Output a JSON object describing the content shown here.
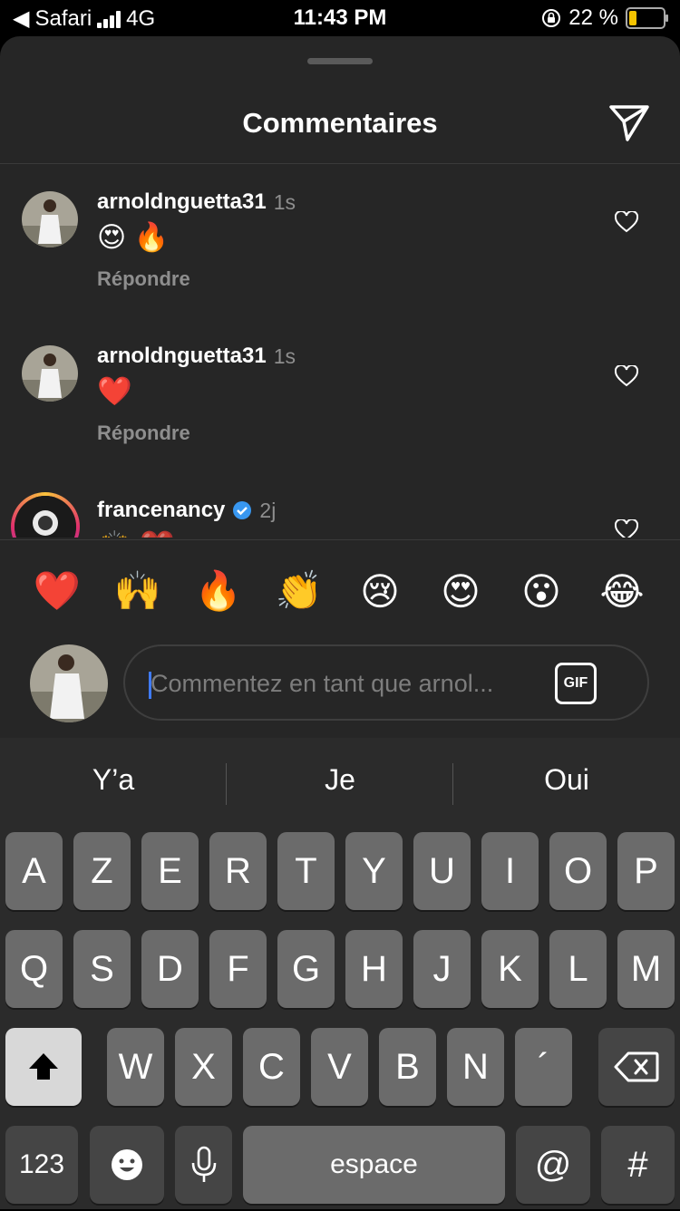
{
  "status_bar": {
    "back_app": "Safari",
    "network": "4G",
    "time": "11:43 PM",
    "battery_percent": "22 %",
    "battery_level": 0.22
  },
  "sheet": {
    "title": "Commentaires"
  },
  "comments": [
    {
      "username": "arnoldnguetta31",
      "time": "1s",
      "text": "😍 🔥",
      "reply_label": "Répondre",
      "verified": false
    },
    {
      "username": "arnoldnguetta31",
      "time": "1s",
      "text": "❤️",
      "reply_label": "Répondre",
      "verified": false
    },
    {
      "username": "francenancy",
      "time": "2j",
      "text": "🙌 ❤️",
      "verified": true
    }
  ],
  "reactions": [
    "❤️",
    "🙌",
    "🔥",
    "👏",
    "😢",
    "😍",
    "😮",
    "😂"
  ],
  "composer": {
    "placeholder": "Commentez en tant que arnol...",
    "gif_label": "GIF"
  },
  "keyboard": {
    "suggestions": [
      "Y’a",
      "Je",
      "Oui"
    ],
    "row1": [
      "A",
      "Z",
      "E",
      "R",
      "T",
      "Y",
      "U",
      "I",
      "O",
      "P"
    ],
    "row2": [
      "Q",
      "S",
      "D",
      "F",
      "G",
      "H",
      "J",
      "K",
      "L",
      "M"
    ],
    "row3": [
      "W",
      "X",
      "C",
      "V",
      "B",
      "N",
      "´"
    ],
    "numbers_key": "123",
    "space_key": "espace",
    "at_key": "@",
    "hash_key": "#"
  },
  "colors": {
    "sheet_bg": "#262626",
    "secondary_text": "#8e8e8e",
    "verified_blue": "#3897f0",
    "caret_blue": "#3f7bff"
  }
}
